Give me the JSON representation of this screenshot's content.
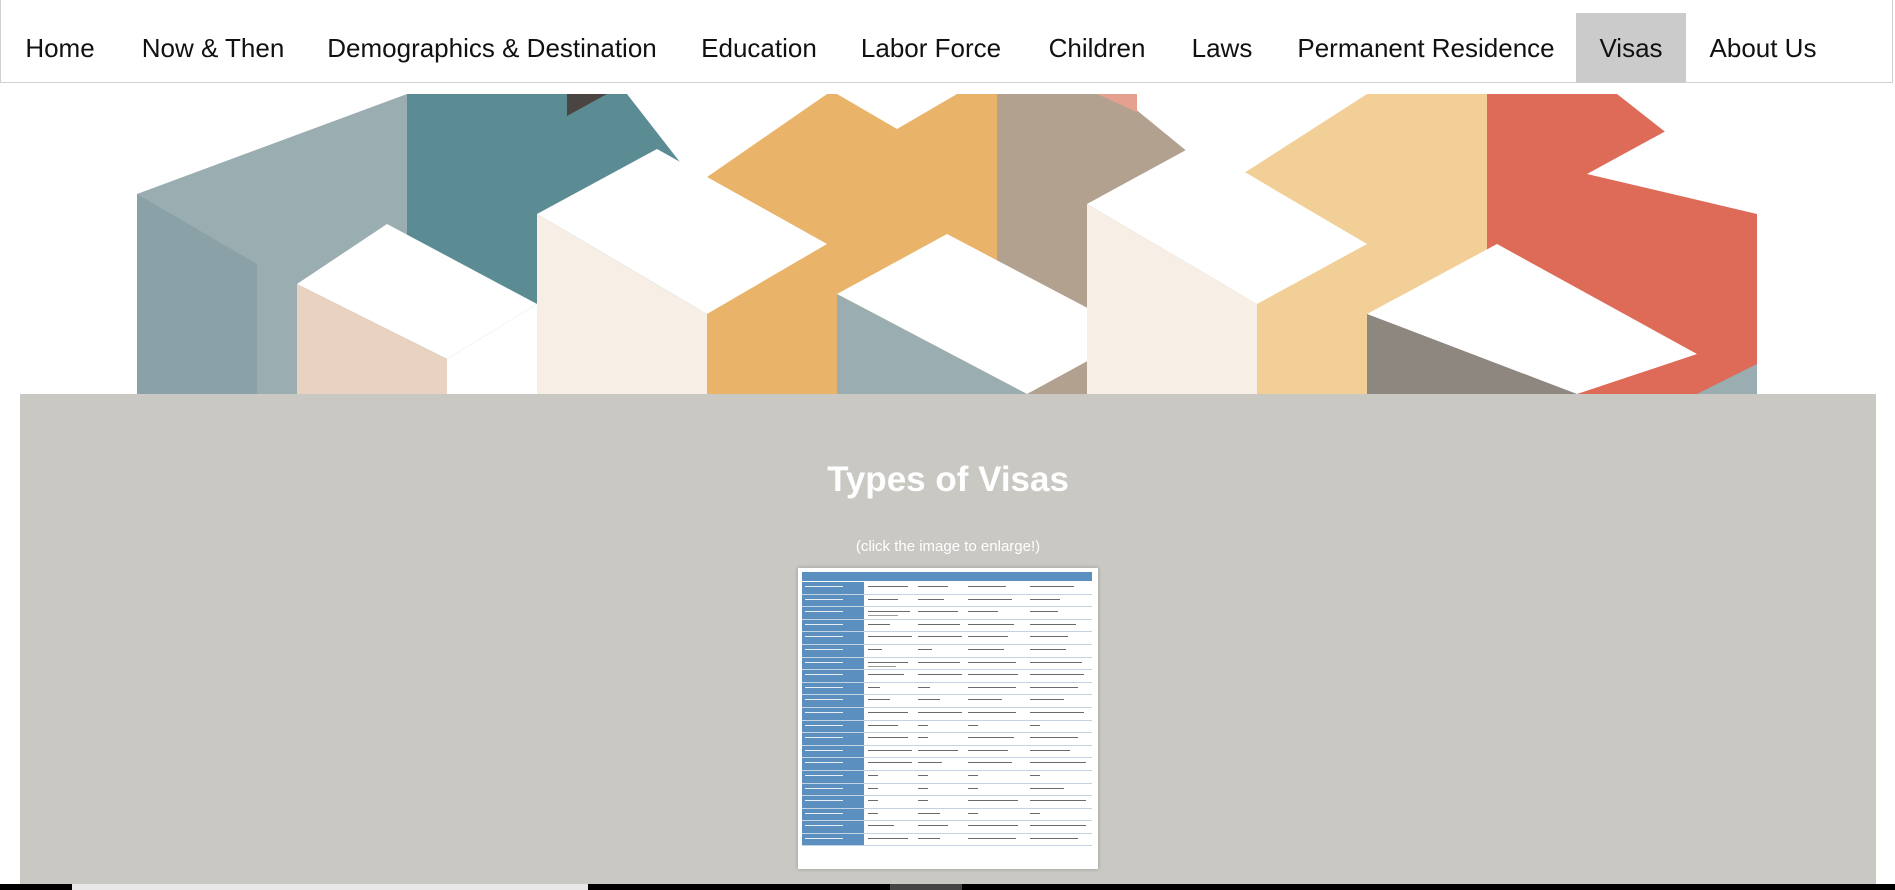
{
  "nav": {
    "items": [
      {
        "label": "Home",
        "active": false
      },
      {
        "label": "Now & Then",
        "active": false
      },
      {
        "label": "Demographics & Destination",
        "active": false
      },
      {
        "label": "Education",
        "active": false
      },
      {
        "label": "Labor Force",
        "active": false
      },
      {
        "label": "Children",
        "active": false
      },
      {
        "label": "Laws",
        "active": false
      },
      {
        "label": "Permanent Residence",
        "active": false
      },
      {
        "label": "Visas",
        "active": true
      },
      {
        "label": "About Us",
        "active": false
      }
    ]
  },
  "hero": {
    "palette": [
      "#9aaeb2",
      "#5b8c94",
      "#eab36a",
      "#b3a190",
      "#f1cf97",
      "#de6a58",
      "#e8d3c3",
      "#8e8780",
      "#ffffff"
    ]
  },
  "main": {
    "title": "Types of Visas",
    "subtitle": "(click the image to enlarge!)"
  },
  "colors": {
    "panel_bg": "#cac8c3",
    "active_nav_bg": "#cbcbcb",
    "table_header": "#5b8fc0"
  }
}
